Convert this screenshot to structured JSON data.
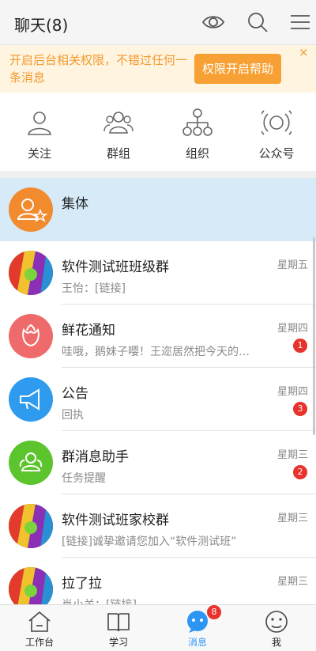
{
  "header": {
    "title": "聊天(8)",
    "icons": [
      "eye-icon",
      "search-icon",
      "menu-icon"
    ]
  },
  "banner": {
    "text": "开启后台相关权限，不错过任何一条消息",
    "button_label": "权限开启帮助",
    "close_symbol": "×"
  },
  "quick_actions": [
    {
      "label": "关注",
      "icon": "person-icon"
    },
    {
      "label": "群组",
      "icon": "group-icon"
    },
    {
      "label": "组织",
      "icon": "org-chart-icon"
    },
    {
      "label": "公众号",
      "icon": "broadcast-icon"
    }
  ],
  "chats": [
    {
      "name": "集体",
      "preview": "",
      "time": "",
      "badge": "",
      "avatar": "group-star-icon",
      "selected": true
    },
    {
      "name": "软件测试班班级群",
      "preview": "王怡：[链接]",
      "time": "星期五",
      "badge": "",
      "avatar": "colorful-photo"
    },
    {
      "name": "鲜花通知",
      "preview": "哇哦，鹅妹子嘤！王迩居然把今天的…",
      "time": "星期四",
      "badge": "1",
      "avatar": "flower-icon"
    },
    {
      "name": "公告",
      "preview": "回执",
      "time": "星期四",
      "badge": "3",
      "avatar": "megaphone-icon"
    },
    {
      "name": "群消息助手",
      "preview": "任务提醒",
      "time": "星期三",
      "badge": "2",
      "avatar": "group-assistant-icon"
    },
    {
      "name": "软件测试班家校群",
      "preview": "[链接]诚挚邀请您加入“软件测试班”",
      "time": "星期三",
      "badge": "",
      "avatar": "colorful-photo"
    },
    {
      "name": "拉了拉",
      "preview": "肖小关：[链接]",
      "time": "星期三",
      "badge": "",
      "avatar": "colorful-photo"
    }
  ],
  "tabbar": {
    "items": [
      {
        "label": "工作台",
        "icon": "house-icon"
      },
      {
        "label": "学习",
        "icon": "book-icon"
      },
      {
        "label": "消息",
        "icon": "chat-bubble-icon",
        "badge": "8",
        "active": true
      },
      {
        "label": "我",
        "icon": "profile-icon"
      }
    ]
  },
  "colors": {
    "accent_blue": "#2d96f5",
    "banner_orange": "#f7a033",
    "badge_red": "#e8322c",
    "selected_row": "#d6eaf8"
  }
}
